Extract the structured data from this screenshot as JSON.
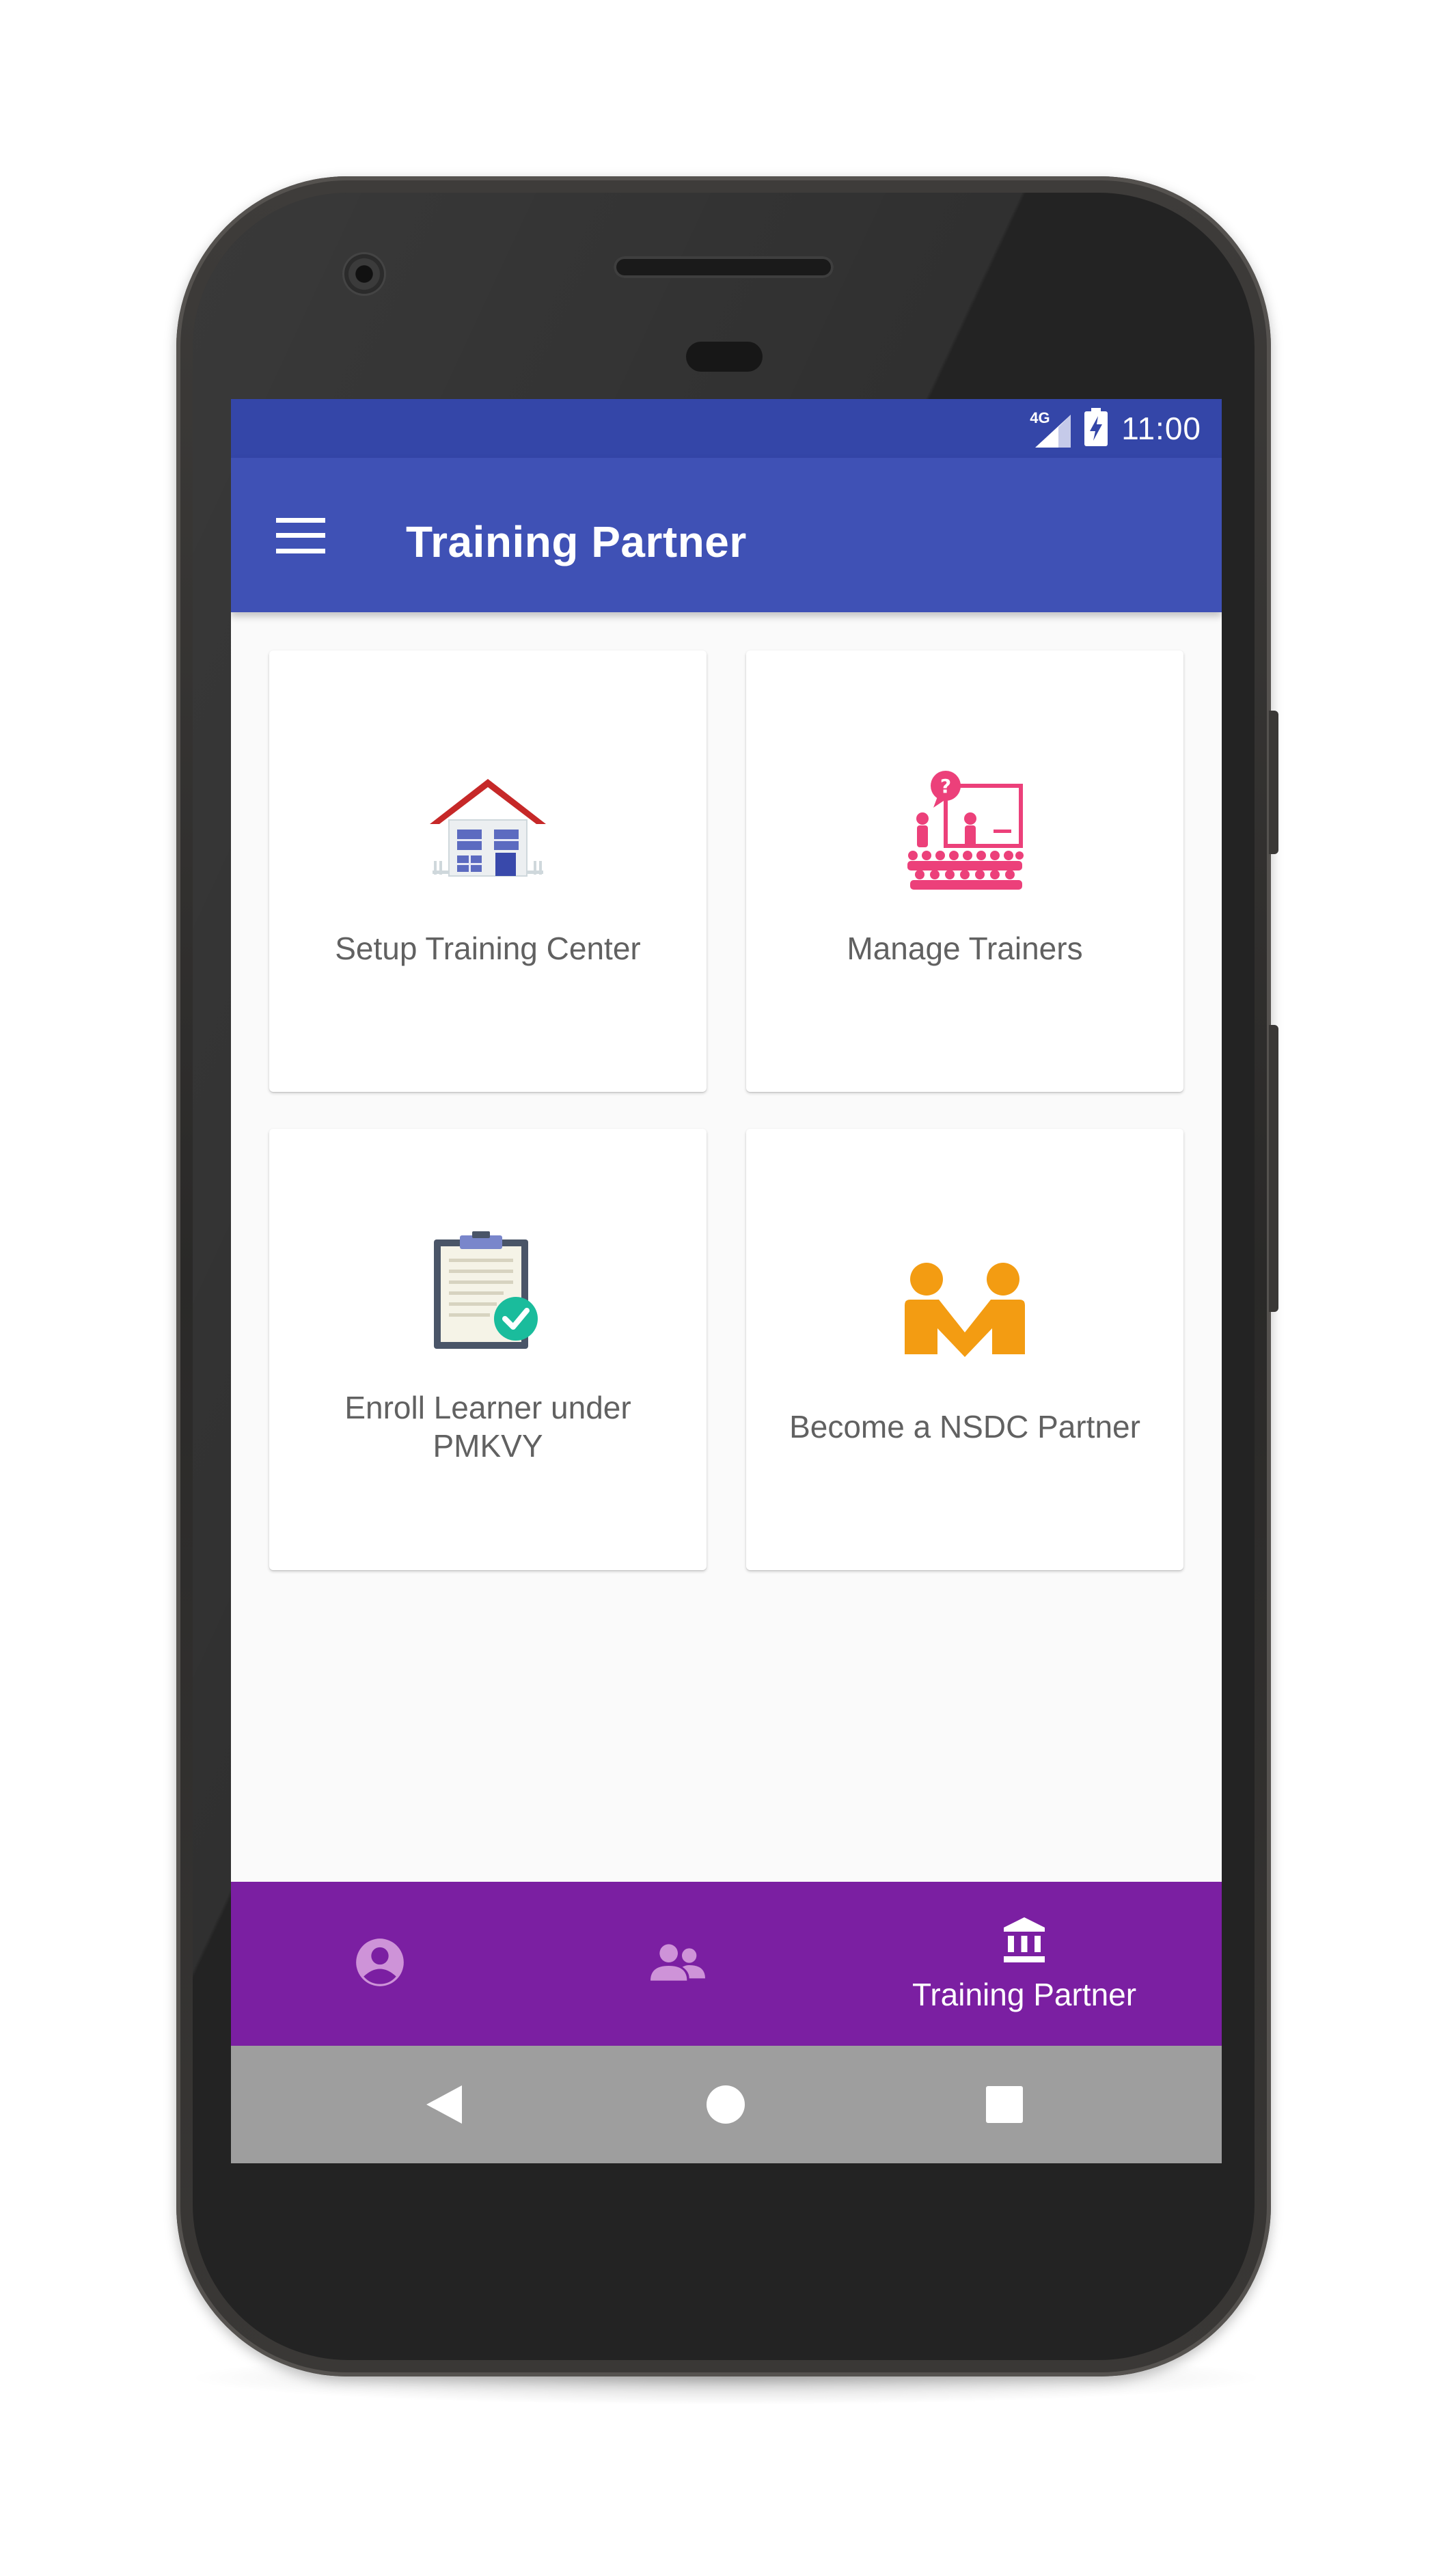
{
  "status_bar": {
    "network": "4G",
    "time": "11:00"
  },
  "app_bar": {
    "title": "Training Partner",
    "menu_icon": "hamburger-menu-icon"
  },
  "cards": [
    {
      "label": "Setup Training Center",
      "icon": "house-icon"
    },
    {
      "label": "Manage Trainers",
      "icon": "classroom-icon"
    },
    {
      "label": "Enroll Learner under PMKVY",
      "icon": "clipboard-check-icon"
    },
    {
      "label": "Become a NSDC Partner",
      "icon": "handshake-people-icon"
    }
  ],
  "bottom_nav": {
    "items": [
      {
        "icon": "account-circle-icon",
        "label": ""
      },
      {
        "icon": "people-icon",
        "label": ""
      },
      {
        "icon": "institution-icon",
        "label": "Training Partner"
      }
    ]
  },
  "system_nav": {
    "items": [
      "back-triangle-icon",
      "home-circle-icon",
      "recents-square-icon"
    ]
  },
  "colors": {
    "status_bar": "#3446a8",
    "app_bar": "#3f51b5",
    "bottom_nav": "#7b1fa2",
    "system_nav": "#9e9e9e",
    "card_text": "#616161",
    "house_roof": "#c62828",
    "trainers_accent": "#ec407a",
    "partner_accent": "#f39c12",
    "check_badge": "#1abc9c"
  }
}
